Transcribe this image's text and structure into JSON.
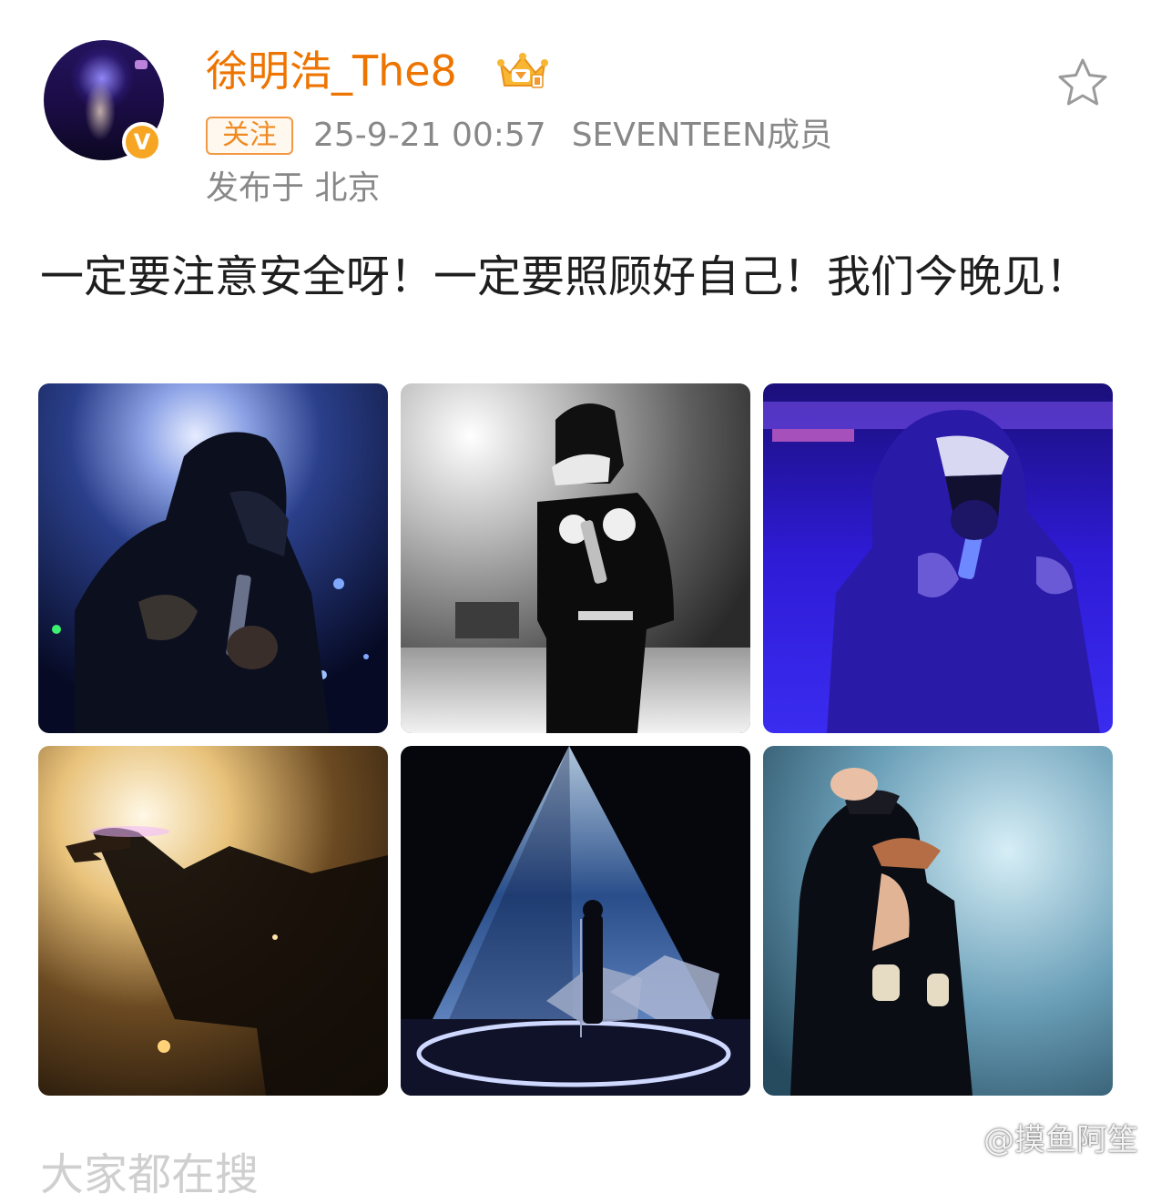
{
  "user": {
    "name": "徐明浩_The8",
    "avatar_icon": "avatar",
    "verified_badge": "V",
    "member_crown_icon": "vip-crown-icon"
  },
  "actions": {
    "follow_label": "关注",
    "favorite_icon": "star-icon"
  },
  "meta": {
    "timestamp": "25-9-21 00:57",
    "source": "SEVENTEEN成员",
    "location": "发布于 北京"
  },
  "post": {
    "text": "一定要注意安全呀！一定要照顾好自己！我们今晚见！"
  },
  "photos": [
    {
      "name": "photo-1"
    },
    {
      "name": "photo-2"
    },
    {
      "name": "photo-3"
    },
    {
      "name": "photo-4"
    },
    {
      "name": "photo-5"
    },
    {
      "name": "photo-6"
    }
  ],
  "below_fold": {
    "text": "大家都在搜"
  },
  "watermark": {
    "text": "@摸鱼阿笙"
  },
  "colors": {
    "username": "#ee7400",
    "follow_border": "#f19944",
    "meta_text": "#888888",
    "body_text": "#1e1e1e",
    "verified_badge": "#f6a623"
  }
}
